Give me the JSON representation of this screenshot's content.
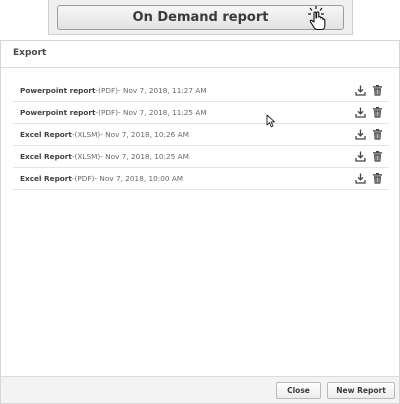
{
  "top": {
    "on_demand_label": "On Demand report"
  },
  "dialog": {
    "title": "Export",
    "rows": [
      {
        "name": "Powerpoint report",
        "sep": " - ",
        "format": "(PDF)",
        "date": " - Nov 7, 2018, 11:27 AM"
      },
      {
        "name": "Powerpoint report",
        "sep": " - ",
        "format": "(PDF)",
        "date": " - Nov 7, 2018, 11:25 AM"
      },
      {
        "name": "Excel Report",
        "sep": " - ",
        "format": "(XLSM)",
        "date": " - Nov 7, 2018, 10:26 AM"
      },
      {
        "name": "Excel Report",
        "sep": " - ",
        "format": "(XLSM)",
        "date": " - Nov 7, 2018, 10:25 AM"
      },
      {
        "name": "Excel Report",
        "sep": " - ",
        "format": "(PDF)",
        "date": " - Nov 7, 2018, 10:00 AM"
      }
    ],
    "row_icons": [
      "download-icon",
      "trash-icon"
    ],
    "footer": {
      "close_label": "Close",
      "new_report_label": "New Report"
    }
  },
  "colors": {
    "text": "#333333",
    "border": "#d6d6d6",
    "footer_bg": "#f3f3f3"
  }
}
